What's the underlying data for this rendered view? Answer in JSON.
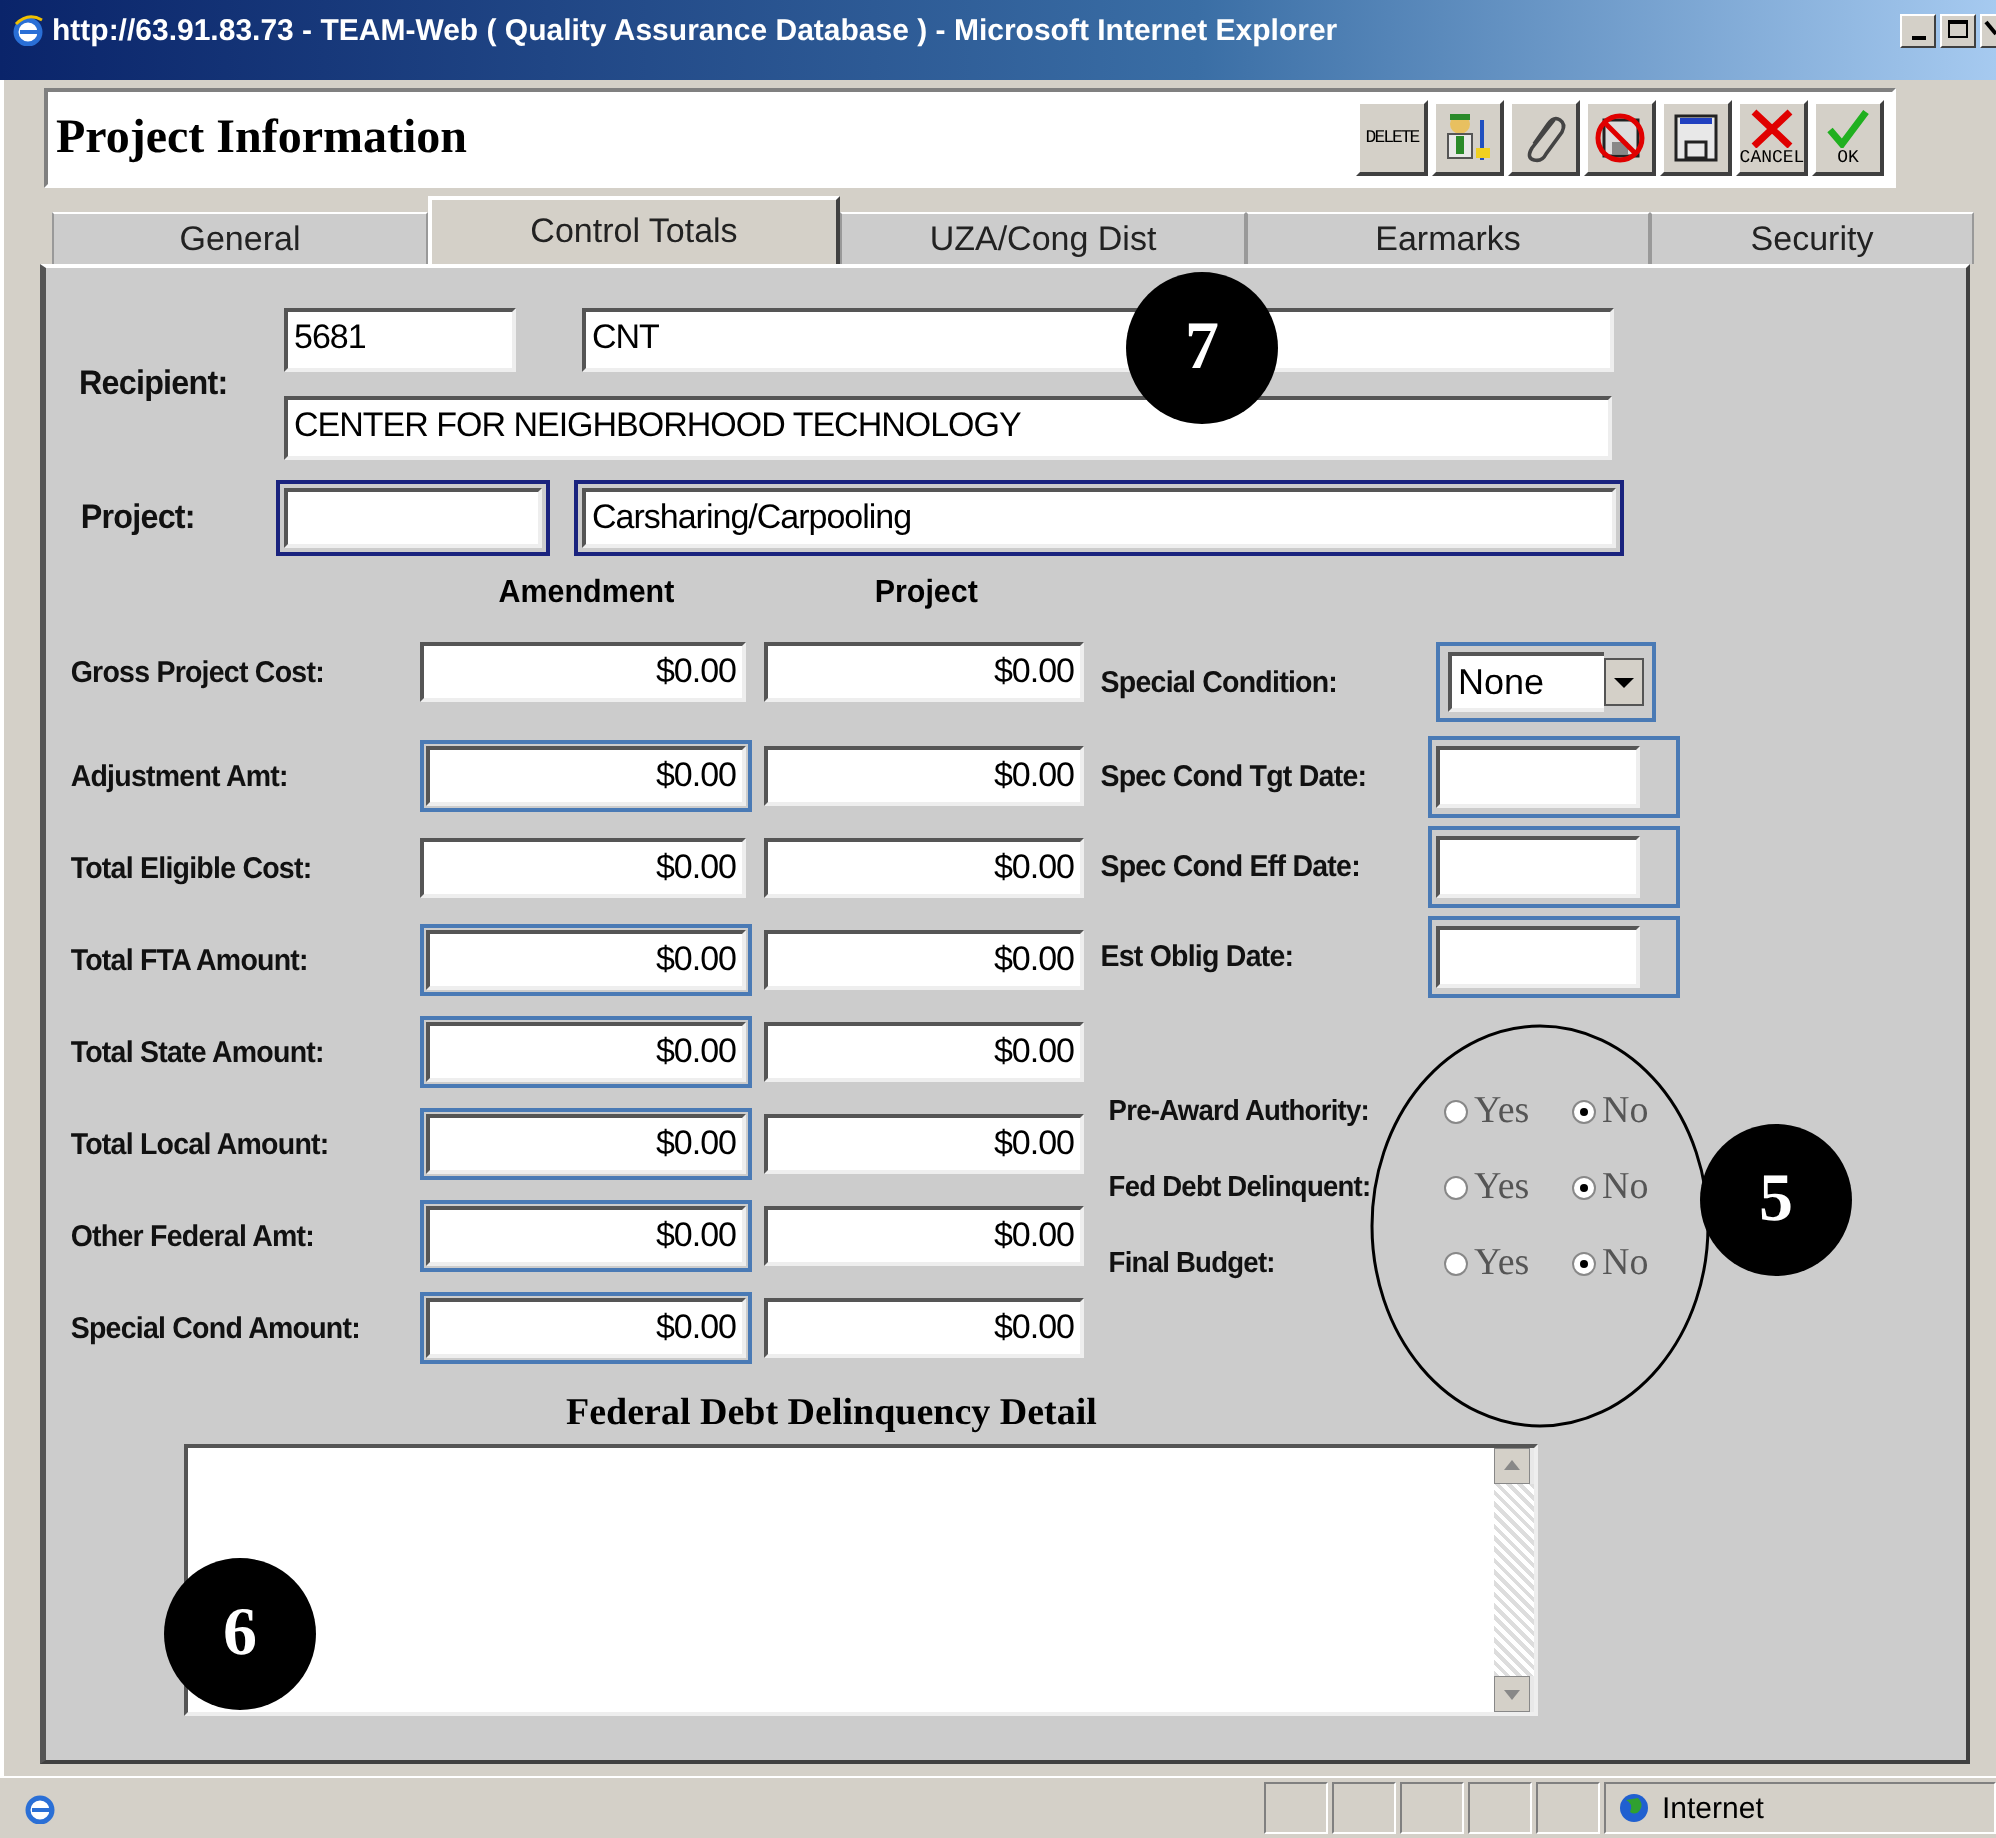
{
  "window": {
    "title": "http://63.91.83.73 - TEAM-Web ( Quality Assurance Database ) - Microsoft Internet Explorer"
  },
  "header": {
    "title": "Project Information",
    "toolbar": [
      {
        "kind": "delete",
        "label": "DELETE"
      },
      {
        "kind": "person"
      },
      {
        "kind": "attach"
      },
      {
        "kind": "nosave"
      },
      {
        "kind": "save"
      },
      {
        "kind": "cancel",
        "label": "CANCEL"
      },
      {
        "kind": "ok",
        "label": "OK"
      }
    ]
  },
  "tabs": [
    {
      "label": "General",
      "selected": false
    },
    {
      "label": "Control Totals",
      "selected": true
    },
    {
      "label": "UZA/Cong Dist",
      "selected": false
    },
    {
      "label": "Earmarks",
      "selected": false
    },
    {
      "label": "Security",
      "selected": false
    }
  ],
  "recipient": {
    "label": "Recipient:",
    "code": "5681",
    "short_name": "CNT",
    "name": "CENTER FOR NEIGHBORHOOD TECHNOLOGY"
  },
  "project": {
    "label": "Project:",
    "title": "Carsharing/Carpooling"
  },
  "columns": [
    "Amendment",
    "Project"
  ],
  "amounts": [
    {
      "label": "Gross Project Cost:",
      "amendment": "$0.00",
      "project": "$0.00",
      "framed": false
    },
    {
      "label": "Adjustment Amt:",
      "amendment": "$0.00",
      "project": "$0.00",
      "framed": true
    },
    {
      "label": "Total Eligible Cost:",
      "amendment": "$0.00",
      "project": "$0.00",
      "framed": false
    },
    {
      "label": "Total FTA Amount:",
      "amendment": "$0.00",
      "project": "$0.00",
      "framed": true
    },
    {
      "label": "Total State Amount:",
      "amendment": "$0.00",
      "project": "$0.00",
      "framed": true
    },
    {
      "label": "Total Local Amount:",
      "amendment": "$0.00",
      "project": "$0.00",
      "framed": true
    },
    {
      "label": "Other Federal Amt:",
      "amendment": "$0.00",
      "project": "$0.00",
      "framed": true
    },
    {
      "label": "Special Cond Amount:",
      "amendment": "$0.00",
      "project": "$0.00",
      "framed": true
    }
  ],
  "conditions": [
    {
      "kind": "select",
      "label": "Special Condition:",
      "value": "None"
    },
    {
      "kind": "date",
      "label": "Spec Cond Tgt Date:"
    },
    {
      "kind": "date",
      "label": "Spec Cond Eff Date:"
    },
    {
      "kind": "date",
      "label": "Est Oblig Date:"
    }
  ],
  "flags": [
    {
      "label": "Pre-Award Authority:",
      "options": [
        {
          "label": "Yes",
          "selected": false
        },
        {
          "label": "No",
          "selected": true
        }
      ]
    },
    {
      "label": "Fed Debt Delinquent:",
      "options": [
        {
          "label": "Yes",
          "selected": false
        },
        {
          "label": "No",
          "selected": true
        }
      ]
    },
    {
      "label": "Final Budget:",
      "options": [
        {
          "label": "Yes",
          "selected": false
        },
        {
          "label": "No",
          "selected": true
        }
      ]
    }
  ],
  "detail": {
    "title": "Federal Debt Delinquency Detail"
  },
  "callouts": [
    "7",
    "5",
    "6"
  ],
  "status_bar": {
    "zone": "Internet"
  }
}
